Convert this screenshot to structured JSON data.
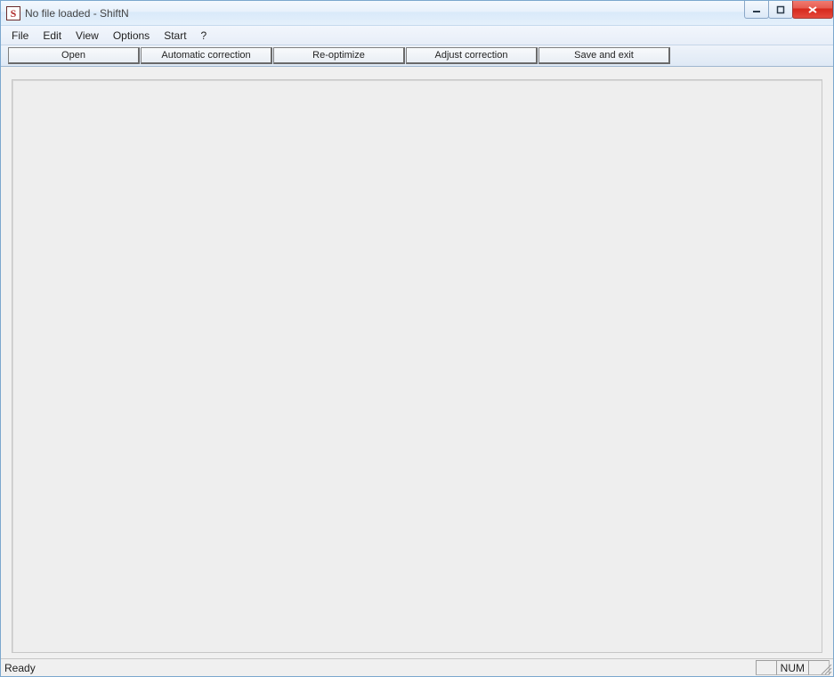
{
  "window": {
    "title": "No file loaded - ShiftN",
    "app_icon_letter": "S"
  },
  "menubar": {
    "items": [
      "File",
      "Edit",
      "View",
      "Options",
      "Start",
      "?"
    ]
  },
  "toolbar": {
    "buttons": [
      {
        "label": "Open"
      },
      {
        "label": "Automatic correction"
      },
      {
        "label": "Re-optimize"
      },
      {
        "label": "Adjust correction"
      },
      {
        "label": "Save and exit"
      }
    ]
  },
  "statusbar": {
    "text": "Ready",
    "num": "NUM"
  }
}
